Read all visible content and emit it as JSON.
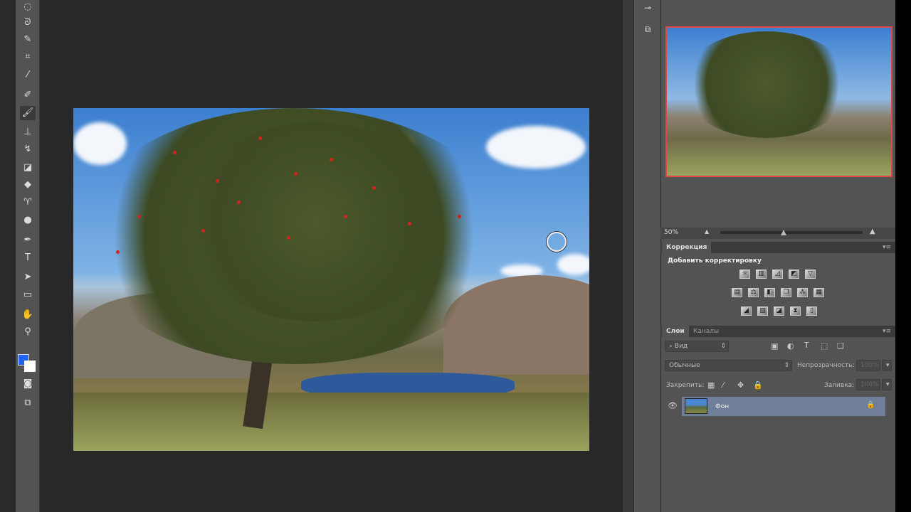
{
  "toolbar": {
    "tools": [
      {
        "name": "ellipse-marquee-icon",
        "glyph": "◌"
      },
      {
        "name": "lasso-icon",
        "glyph": "ᘐ"
      },
      {
        "name": "quick-select-icon",
        "glyph": "✎"
      },
      {
        "name": "crop-icon",
        "glyph": "⌗"
      },
      {
        "name": "eyedropper-icon",
        "glyph": "⁄"
      },
      {
        "name": "healing-brush-icon",
        "glyph": "✐"
      },
      {
        "name": "brush-icon",
        "glyph": "🖌"
      },
      {
        "name": "stamp-icon",
        "glyph": "⊥"
      },
      {
        "name": "history-brush-icon",
        "glyph": "↯"
      },
      {
        "name": "eraser-icon",
        "glyph": "◪"
      },
      {
        "name": "paint-bucket-icon",
        "glyph": "◆"
      },
      {
        "name": "blur-icon",
        "glyph": "♈"
      },
      {
        "name": "dodge-icon",
        "glyph": "●"
      },
      {
        "name": "pen-icon",
        "glyph": "✒"
      },
      {
        "name": "type-icon",
        "glyph": "T"
      },
      {
        "name": "path-select-icon",
        "glyph": "➤"
      },
      {
        "name": "rectangle-icon",
        "glyph": "▭"
      },
      {
        "name": "hand-icon",
        "glyph": "✋"
      },
      {
        "name": "zoom-icon",
        "glyph": "⚲"
      }
    ],
    "active": "brush-icon",
    "colors": {
      "foreground": "#1f63f0",
      "background": "#ffffff"
    }
  },
  "navigator": {
    "zoom": "50%",
    "slider_level": 0.45
  },
  "adjustments": {
    "tab": "Коррекция",
    "title": "Добавить корректировку",
    "rows": [
      [
        "☼",
        "▥",
        "◿",
        "◩",
        "▽"
      ],
      [
        "▤",
        "⚖",
        "◧",
        "❐",
        "⁂",
        "▦"
      ],
      [
        "◢",
        "▨",
        "◪",
        "⧗",
        "▯"
      ]
    ]
  },
  "layers": {
    "tabs": [
      "Слои",
      "Каналы"
    ],
    "filter": "Вид",
    "blend": "Обычные",
    "opacity_label": "Непрозрачность:",
    "opacity": "100%",
    "lock_label": "Закрепить:",
    "fill_label": "Заливка:",
    "fill": "100%",
    "items": [
      {
        "name": "Фон",
        "visible": true,
        "locked": true
      }
    ]
  },
  "accent": "#e04848"
}
